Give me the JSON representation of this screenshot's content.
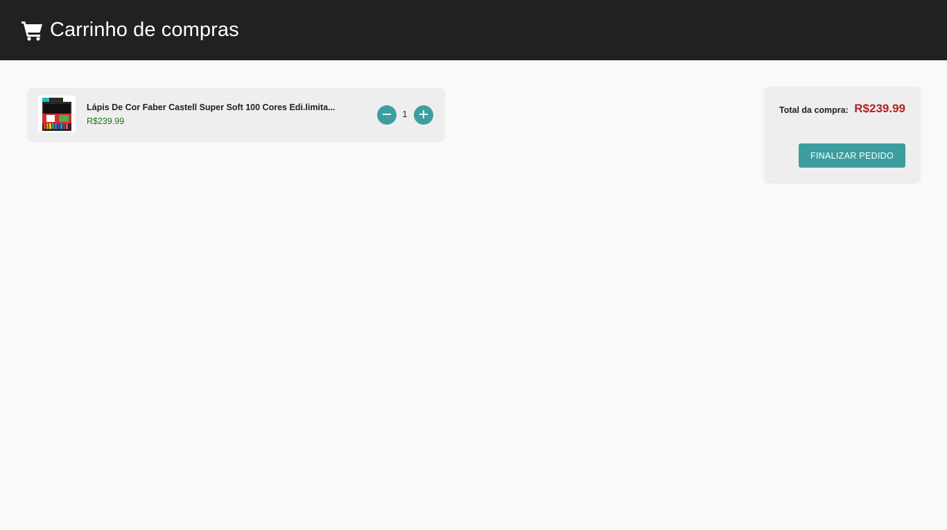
{
  "header": {
    "title": "Carrinho de compras",
    "icon": "shopping-cart-icon"
  },
  "cart": {
    "items": [
      {
        "name": "Lápis De Cor Faber Castell Super Soft 100 Cores Edi.limita...",
        "price": "R$239.99",
        "quantity": "1"
      }
    ]
  },
  "summary": {
    "total_label": "Total da compra:",
    "total_value": "R$239.99",
    "checkout_label": "FINALIZAR PEDIDO"
  },
  "colors": {
    "header_bg": "#212121",
    "accent": "#3d9ea0",
    "price_green": "#1a7a1a",
    "total_red": "#b22222"
  }
}
